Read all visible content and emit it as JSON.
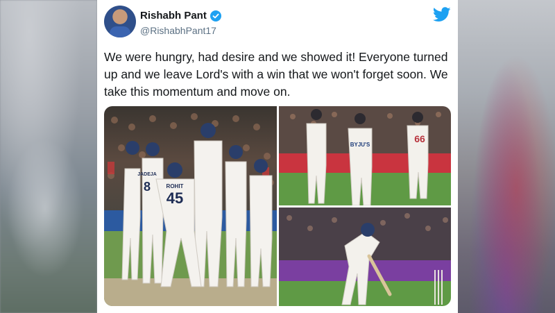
{
  "tweet": {
    "author": {
      "display_name": "Rishabh Pant",
      "handle": "@RishabhPant17",
      "verified": true
    },
    "text": "We were hungry, had desire and we showed it! Everyone turned up and we leave Lord's with a win that we won't forget soon. We take this momentum and move on.",
    "media": [
      {
        "kind": "photo",
        "description_icon": "photo-team-celebration",
        "jersey_texts": [
          "ROHIT",
          "45",
          "JADEJA",
          "8"
        ]
      },
      {
        "kind": "photo",
        "description_icon": "photo-players-celebrating",
        "jersey_texts": [
          "BYJU'S",
          "66"
        ]
      },
      {
        "kind": "photo",
        "description_icon": "photo-batsman-shot",
        "jersey_texts": []
      }
    ]
  },
  "colors": {
    "twitter_blue": "#1da1f2",
    "text_primary": "#14171a",
    "text_secondary": "#5b7083"
  },
  "icons": {
    "verified": "verified-badge-icon",
    "brand": "twitter-bird-icon"
  }
}
